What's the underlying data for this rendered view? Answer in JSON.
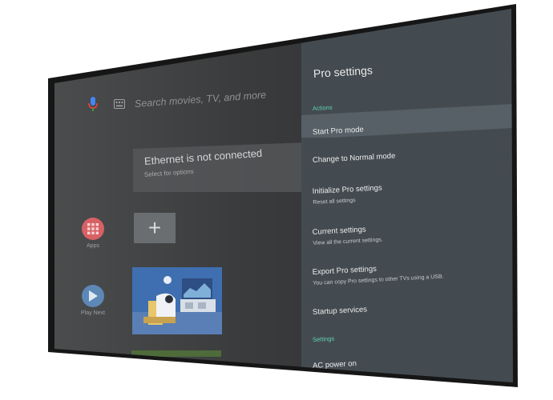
{
  "home": {
    "search_placeholder": "Search movies, TV, and more",
    "network_card": {
      "title": "Ethernet is not connected",
      "subtitle": "Select for options"
    },
    "apps_label": "Apps",
    "play_next_label": "Play Next"
  },
  "pro_panel": {
    "title": "Pro settings",
    "sections": {
      "actions": "Actions",
      "settings": "Settings"
    },
    "items": [
      {
        "title": "Start Pro mode",
        "subtitle": "",
        "selected": true
      },
      {
        "title": "Change to Normal mode",
        "subtitle": ""
      },
      {
        "title": "Initialize Pro settings",
        "subtitle": "Reset all settings"
      },
      {
        "title": "Current settings",
        "subtitle": "View all the current settings."
      },
      {
        "title": "Export Pro settings",
        "subtitle": "You can copy Pro settings to other TVs using a USB."
      },
      {
        "title": "Startup services",
        "subtitle": ""
      },
      {
        "title": "AC power on",
        "subtitle": ""
      }
    ]
  },
  "colors": {
    "panel_bg": "#444b50",
    "section_accent": "#5fd2bd",
    "apps_circle": "#d86165",
    "play_next_circle": "#5d88b6"
  },
  "icons": {
    "search": "mic-icon",
    "keyboard": "keyboard-icon",
    "apps": "grid-icon",
    "play_next": "play-icon",
    "add": "plus-icon"
  }
}
